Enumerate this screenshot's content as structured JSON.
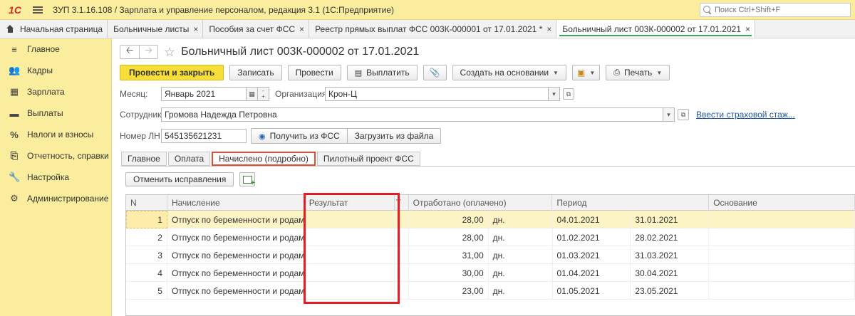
{
  "app": {
    "logo_text": "1С",
    "title": "ЗУП 3.1.16.108 / Зарплата и управление персоналом, редакция 3.1  (1С:Предприятие)",
    "search_placeholder": "Поиск Ctrl+Shift+F"
  },
  "tabs": [
    {
      "label": "Начальная страница"
    },
    {
      "label": "Больничные листы"
    },
    {
      "label": "Пособия за счет ФСС"
    },
    {
      "label": "Реестр прямых выплат ФСС 003К-000001 от 17.01.2021 *"
    },
    {
      "label": "Больничный лист 003К-000002 от 17.01.2021"
    }
  ],
  "tab_close": "×",
  "sidebar": {
    "items": [
      {
        "label": "Главное",
        "icon": "≡"
      },
      {
        "label": "Кадры",
        "icon": "👥"
      },
      {
        "label": "Зарплата",
        "icon": "▦"
      },
      {
        "label": "Выплаты",
        "icon": "▬"
      },
      {
        "label": "Налоги и взносы",
        "icon": "%"
      },
      {
        "label": "Отчетность, справки",
        "icon": "⎘"
      },
      {
        "label": "Настройка",
        "icon": "🔧"
      },
      {
        "label": "Администрирование",
        "icon": "⚙"
      }
    ]
  },
  "document": {
    "title": "Больничный лист 003К-000002 от 17.01.2021",
    "nav_back": "🡠",
    "nav_forward": "🡢",
    "star": "☆"
  },
  "toolbar": {
    "post_close": "Провести и закрыть",
    "save": "Записать",
    "post": "Провести",
    "pay": "Выплатить",
    "create_based": "Создать на основании",
    "print": "Печать"
  },
  "fields": {
    "month_label": "Месяц:",
    "month_value": "Январь 2021",
    "org_label": "Организация:",
    "org_value": "Крон-Ц",
    "employee_label": "Сотрудник:",
    "employee_value": "Громова Надежда Петровна",
    "insurance_link": "Ввести страховой стаж...",
    "ln_label": "Номер ЛН:",
    "ln_value": "545135621231",
    "get_fss": "Получить из ФСС",
    "load_file": "Загрузить из файла"
  },
  "subtabs": [
    {
      "label": "Главное"
    },
    {
      "label": "Оплата"
    },
    {
      "label": "Начислено (подробно)"
    },
    {
      "label": "Пилотный проект ФСС"
    }
  ],
  "inner": {
    "cancel_corrections": "Отменить исправления"
  },
  "table": {
    "headers": {
      "n": "N",
      "accrual": "Начисление",
      "result": "Результат",
      "t": "Т",
      "worked": "Отработано (оплачено)",
      "period": "Период",
      "basis": "Основание"
    },
    "rows": [
      {
        "n": "1",
        "accrual": "Отпуск по беременности и родам",
        "result": "",
        "worked": "28,00",
        "unit": "дн.",
        "from": "04.01.2021",
        "to": "31.01.2021",
        "basis": ""
      },
      {
        "n": "2",
        "accrual": "Отпуск по беременности и родам",
        "result": "",
        "worked": "28,00",
        "unit": "дн.",
        "from": "01.02.2021",
        "to": "28.02.2021",
        "basis": ""
      },
      {
        "n": "3",
        "accrual": "Отпуск по беременности и родам",
        "result": "",
        "worked": "31,00",
        "unit": "дн.",
        "from": "01.03.2021",
        "to": "31.03.2021",
        "basis": ""
      },
      {
        "n": "4",
        "accrual": "Отпуск по беременности и родам",
        "result": "",
        "worked": "30,00",
        "unit": "дн.",
        "from": "01.04.2021",
        "to": "30.04.2021",
        "basis": ""
      },
      {
        "n": "5",
        "accrual": "Отпуск по беременности и родам",
        "result": "",
        "worked": "23,00",
        "unit": "дн.",
        "from": "01.05.2021",
        "to": "23.05.2021",
        "basis": ""
      }
    ]
  },
  "colors": {
    "sidebar_bg": "#fbed9e",
    "primary_button": "#f7de38",
    "active_tab_line": "#3aa856",
    "highlight_red": "#e31e24",
    "selected_row": "#fdf4c6",
    "link": "#1e5aa8"
  }
}
